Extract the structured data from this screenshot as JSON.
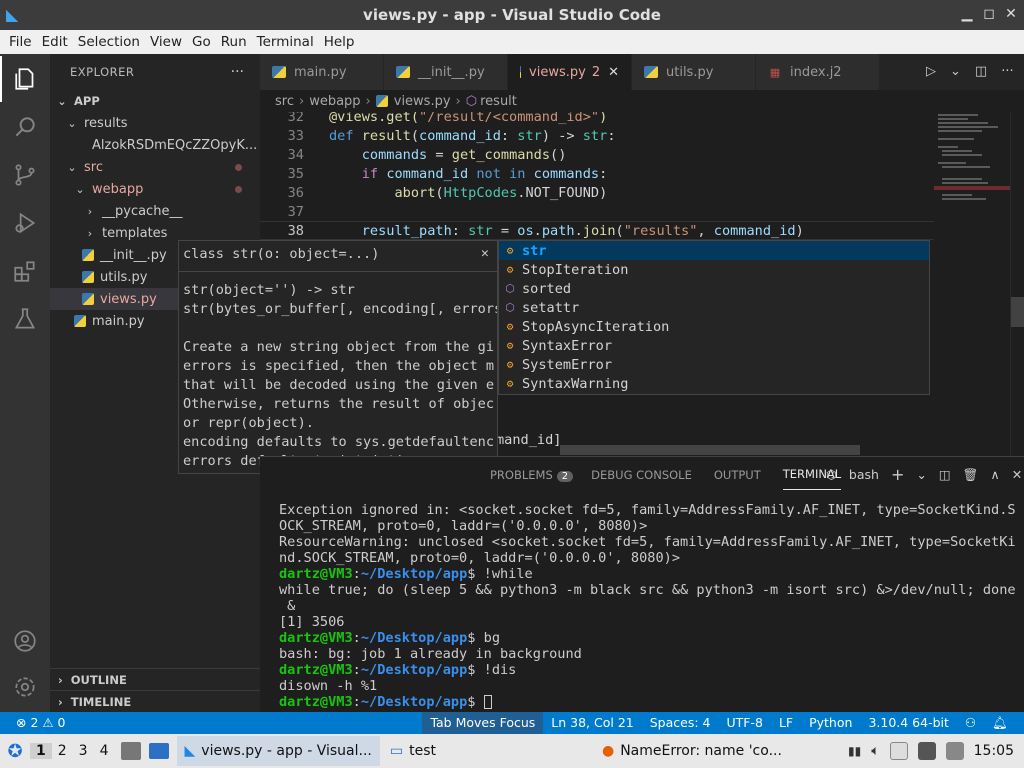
{
  "window": {
    "title": "views.py - app - Visual Studio Code"
  },
  "menu": [
    "File",
    "Edit",
    "Selection",
    "View",
    "Go",
    "Run",
    "Terminal",
    "Help"
  ],
  "sidebar": {
    "title": "EXPLORER",
    "root": "APP",
    "items": [
      {
        "label": "results",
        "kind": "folder",
        "depth": 1
      },
      {
        "label": "AlzokRSDmEQcZZOpyK...",
        "kind": "file",
        "depth": 2
      },
      {
        "label": "src",
        "kind": "folder",
        "depth": 1
      },
      {
        "label": "webapp",
        "kind": "folder",
        "depth": 2
      },
      {
        "label": "__pycache__",
        "kind": "folder",
        "depth": 3
      },
      {
        "label": "templates",
        "kind": "folder",
        "depth": 3
      },
      {
        "label": "__init__.py",
        "kind": "py",
        "depth": 3
      },
      {
        "label": "utils.py",
        "kind": "py",
        "depth": 3
      },
      {
        "label": "views.py",
        "kind": "py",
        "depth": 3
      },
      {
        "label": "main.py",
        "kind": "py",
        "depth": 2
      }
    ],
    "outline": "OUTLINE",
    "timeline": "TIMELINE"
  },
  "tabs": [
    {
      "label": "main.py"
    },
    {
      "label": "__init__.py"
    },
    {
      "label": "views.py",
      "count": "2"
    },
    {
      "label": "utils.py"
    },
    {
      "label": "index.j2"
    }
  ],
  "breadcrumb": [
    "src",
    "webapp",
    "views.py",
    "result"
  ],
  "editor": {
    "lines": [
      {
        "n": "32",
        "code": "@views.get(\"/result/<command_id>\")"
      },
      {
        "n": "33",
        "code": "def result(command_id: str) -> str:"
      },
      {
        "n": "34",
        "code": "    commands = get_commands()"
      },
      {
        "n": "35",
        "code": "    if command_id not in commands:"
      },
      {
        "n": "36",
        "code": "        abort(HttpCodes.NOT_FOUND)"
      },
      {
        "n": "37",
        "code": ""
      },
      {
        "n": "38",
        "code": "    result_path: str = os.path.join(\"results\", command_id)"
      }
    ],
    "trailing": "mand_id]"
  },
  "suggest": [
    {
      "label": "str",
      "kind": "class"
    },
    {
      "label": "StopIteration",
      "kind": "class"
    },
    {
      "label": "sorted",
      "kind": "function"
    },
    {
      "label": "setattr",
      "kind": "function"
    },
    {
      "label": "StopAsyncIteration",
      "kind": "class"
    },
    {
      "label": "SyntaxError",
      "kind": "class"
    },
    {
      "label": "SystemError",
      "kind": "class"
    },
    {
      "label": "SyntaxWarning",
      "kind": "class"
    }
  ],
  "hover": {
    "signature": "class str(o: object=...)",
    "body": "str(object='') -> str\nstr(bytes_or_buffer[, encoding[, errors\n\nCreate a new string object from the gi\nerrors is specified, then the object m\nthat will be decoded using the given e\nOtherwise, returns the result of objec\nor repr(object).\nencoding defaults to sys.getdefaultenc\nerrors defaults to 'strict'."
  },
  "panel": {
    "tabs": [
      {
        "label": "PROBLEMS",
        "badge": "2"
      },
      {
        "label": "DEBUG CONSOLE"
      },
      {
        "label": "OUTPUT"
      },
      {
        "label": "TERMINAL"
      }
    ],
    "shell": "bash",
    "terminal": [
      {
        "text": "Exception ignored in: <socket.socket fd=5, family=AddressFamily.AF_INET, type=SocketKind.S"
      },
      {
        "text": "OCK_STREAM, proto=0, laddr=('0.0.0.0', 8080)>"
      },
      {
        "text": "ResourceWarning: unclosed <socket.socket fd=5, family=AddressFamily.AF_INET, type=SocketKi"
      },
      {
        "text": "nd.SOCK_STREAM, proto=0, laddr=('0.0.0.0', 8080)>"
      },
      {
        "prompt": "dartz@VM3",
        "path": "~/Desktop/app",
        "cmd": "$ !while"
      },
      {
        "text": "while true; do (sleep 5 && python3 -m black src && python3 -m isort src) &>/dev/null; done"
      },
      {
        "text": " &"
      },
      {
        "text": "[1] 3506"
      },
      {
        "prompt": "dartz@VM3",
        "path": "~/Desktop/app",
        "cmd": "$ bg"
      },
      {
        "text": "bash: bg: job 1 already in background"
      },
      {
        "prompt": "dartz@VM3",
        "path": "~/Desktop/app",
        "cmd": "$ !dis"
      },
      {
        "text": "disown -h %1"
      },
      {
        "prompt": "dartz@VM3",
        "path": "~/Desktop/app",
        "cmd": "$ ",
        "cursor": true
      }
    ]
  },
  "status": {
    "problems": "⊗ 2 ⚠ 0",
    "tabfocus": "Tab Moves Focus",
    "position": "Ln 38, Col 21",
    "spaces": "Spaces: 4",
    "encoding": "UTF-8",
    "eol": "LF",
    "language": "Python",
    "interpreter": "3.10.4 64-bit"
  },
  "taskbar": {
    "workspaces": [
      "1",
      "2",
      "3",
      "4"
    ],
    "windows": [
      {
        "label": "views.py - app - Visual...",
        "active": true
      },
      {
        "label": "test"
      },
      {
        "label": "NameError: name 'co..."
      }
    ],
    "clock": "15:05"
  },
  "colors": {
    "accent": "#007acc",
    "activityBar": "#333333",
    "sidebar": "#252526",
    "editor": "#1e1e1e"
  }
}
